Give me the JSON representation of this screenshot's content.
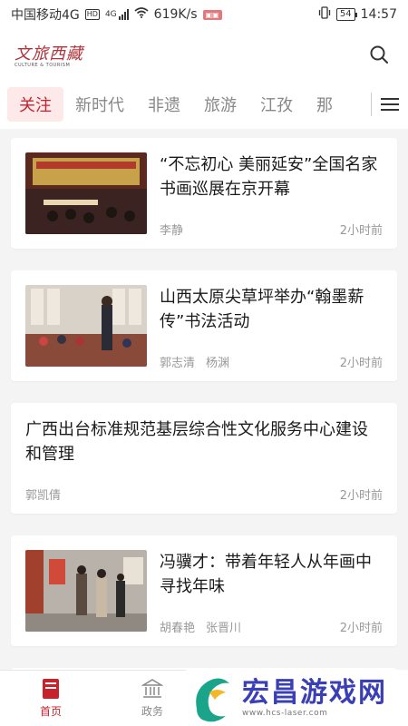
{
  "status_bar": {
    "carrier": "中国移动4G",
    "hd": "HD",
    "net_type": "4G",
    "speed": "619K/s",
    "battery": "54",
    "time": "14:57"
  },
  "header": {
    "logo_text": "文旅西藏",
    "logo_sub": "CULTURE & TOURISM",
    "search_icon": "search-icon"
  },
  "tabs": [
    "关注",
    "新时代",
    "非遗",
    "旅游",
    "江孜",
    "那"
  ],
  "active_tab": 0,
  "articles": [
    {
      "title": "“不忘初心 美丽延安”全国名家书画巡展在京开幕",
      "authors": [
        "李静"
      ],
      "time": "2小时前",
      "has_image": true
    },
    {
      "title": "山西太原尖草坪举办“翰墨薪传”书法活动",
      "authors": [
        "郭志清",
        "杨渊"
      ],
      "time": "2小时前",
      "has_image": true
    },
    {
      "title": "广西出台标准规范基层综合性文化服务中心建设和管理",
      "authors": [
        "郭凯倩"
      ],
      "time": "2小时前",
      "has_image": false
    },
    {
      "title": "冯骥才：带着年轻人从年画中寻找年味",
      "authors": [
        "胡春艳",
        "张晋川"
      ],
      "time": "2小时前",
      "has_image": true
    }
  ],
  "bottom_nav": [
    {
      "label": "首页",
      "icon": "home-icon"
    },
    {
      "label": "政务",
      "icon": "government-icon"
    }
  ],
  "watermark": {
    "text": "宏昌游戏网",
    "url": "www.hcs-laser.com"
  },
  "colors": {
    "accent": "#c6242d",
    "accent_bg": "#fde9ea",
    "watermark": "#3a3fb5"
  }
}
